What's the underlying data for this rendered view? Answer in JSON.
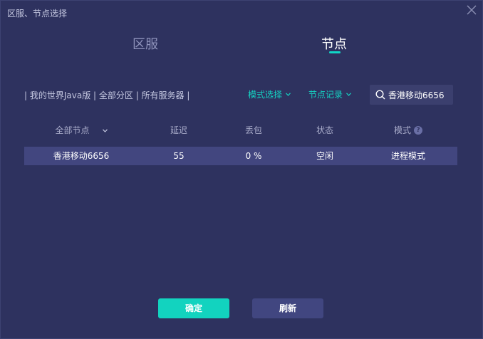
{
  "window": {
    "title": "区服、节点选择"
  },
  "tabs": {
    "region": "区服",
    "node": "节点"
  },
  "breadcrumb": "| 我的世界Java版 | 全部分区 | 所有服务器 |",
  "filters": {
    "mode_select": "模式选择",
    "node_record": "节点记录"
  },
  "search": {
    "value": "香港移动6656"
  },
  "table": {
    "headers": {
      "node": "全部节点",
      "latency": "延迟",
      "loss": "丢包",
      "status": "状态",
      "mode": "模式"
    },
    "rows": [
      {
        "node": "香港移动6656",
        "latency": "55",
        "loss": "0 %",
        "status": "空闲",
        "mode": "进程模式"
      }
    ]
  },
  "buttons": {
    "confirm": "确定",
    "refresh": "刷新"
  },
  "colors": {
    "background": "#2e325f",
    "accent": "#12d3bf",
    "selected_row": "#42467f",
    "secondary_button": "#414680"
  },
  "icons": {
    "close": "close-icon",
    "search": "search-icon",
    "dropdown": "chevron-down-icon",
    "help": "help-icon"
  }
}
